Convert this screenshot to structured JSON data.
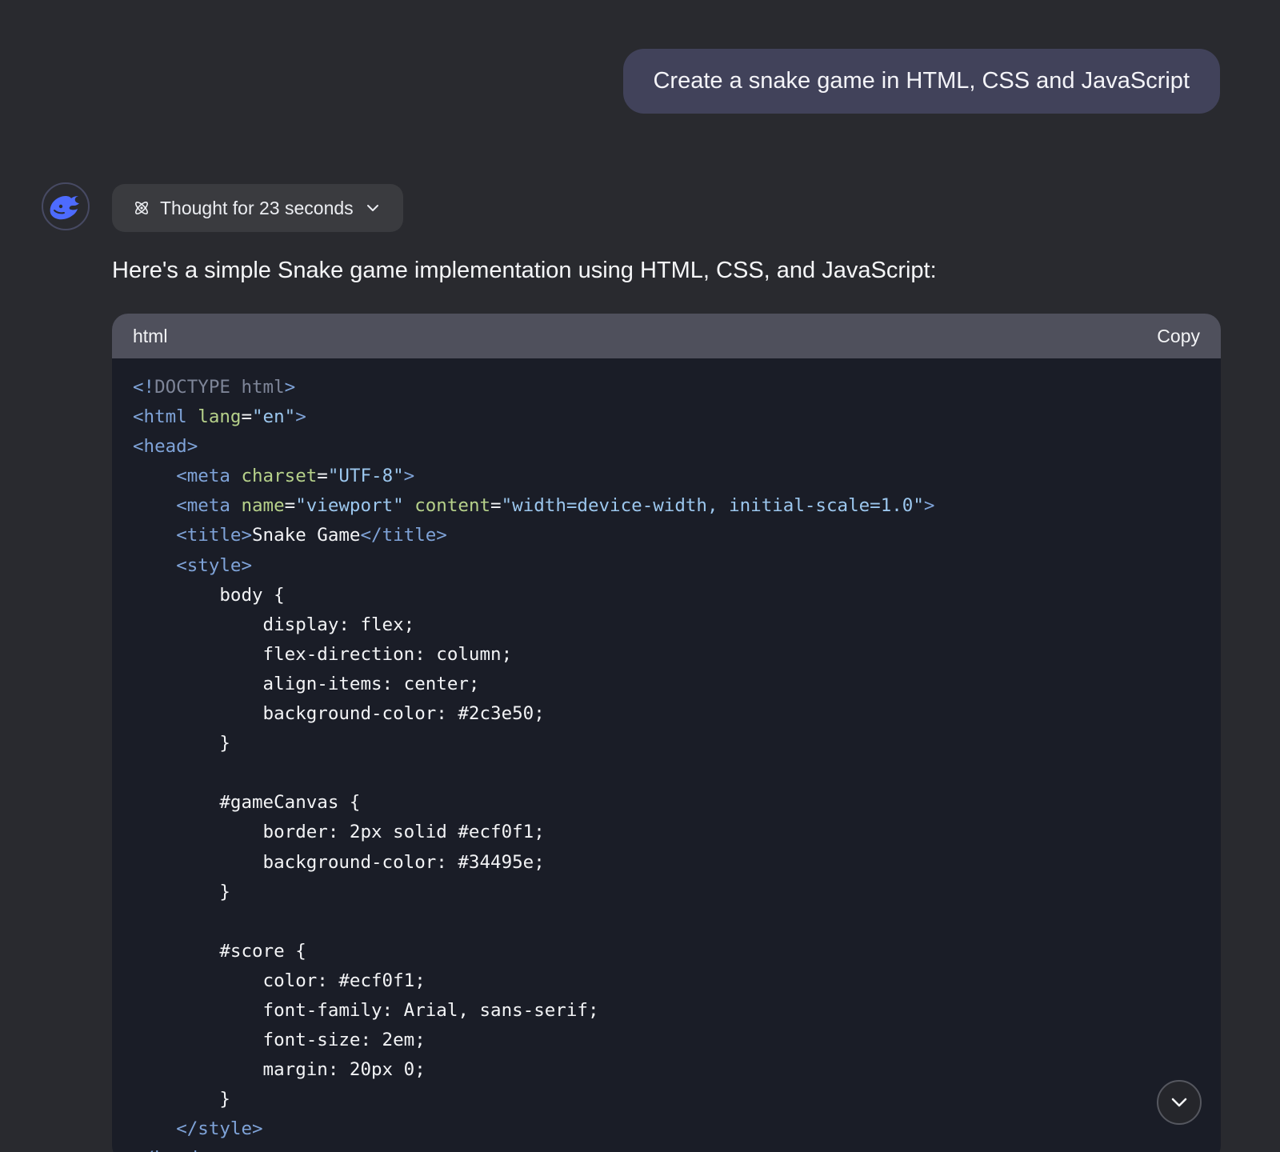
{
  "user_message": "Create a snake game in HTML, CSS and JavaScript",
  "assistant": {
    "avatar_icon": "whale-logo-icon",
    "thought_label": "Thought for 23 seconds",
    "intro_text": "Here's a simple Snake game implementation using HTML, CSS, and JavaScript:",
    "code_block": {
      "language": "html",
      "copy_label": "Copy",
      "lines": [
        [
          {
            "t": "<!",
            "c": "t-bracket"
          },
          {
            "t": "DOCTYPE html",
            "c": "t-doc"
          },
          {
            "t": ">",
            "c": "t-bracket"
          }
        ],
        [
          {
            "t": "<html ",
            "c": "t-tag"
          },
          {
            "t": "lang",
            "c": "t-attr"
          },
          {
            "t": "=",
            "c": "t-plain"
          },
          {
            "t": "\"en\"",
            "c": "t-str"
          },
          {
            "t": ">",
            "c": "t-tag"
          }
        ],
        [
          {
            "t": "<head>",
            "c": "t-tag"
          }
        ],
        [
          {
            "t": "    ",
            "c": "t-plain"
          },
          {
            "t": "<meta ",
            "c": "t-tag"
          },
          {
            "t": "charset",
            "c": "t-attr"
          },
          {
            "t": "=",
            "c": "t-plain"
          },
          {
            "t": "\"UTF-8\"",
            "c": "t-str"
          },
          {
            "t": ">",
            "c": "t-tag"
          }
        ],
        [
          {
            "t": "    ",
            "c": "t-plain"
          },
          {
            "t": "<meta ",
            "c": "t-tag"
          },
          {
            "t": "name",
            "c": "t-attr"
          },
          {
            "t": "=",
            "c": "t-plain"
          },
          {
            "t": "\"viewport\" ",
            "c": "t-str"
          },
          {
            "t": "content",
            "c": "t-attr"
          },
          {
            "t": "=",
            "c": "t-plain"
          },
          {
            "t": "\"width=device-width, initial-scale=1.0\"",
            "c": "t-str"
          },
          {
            "t": ">",
            "c": "t-tag"
          }
        ],
        [
          {
            "t": "    ",
            "c": "t-plain"
          },
          {
            "t": "<title>",
            "c": "t-tag"
          },
          {
            "t": "Snake Game",
            "c": "t-plain"
          },
          {
            "t": "</title>",
            "c": "t-tag"
          }
        ],
        [
          {
            "t": "    ",
            "c": "t-plain"
          },
          {
            "t": "<style>",
            "c": "t-tag"
          }
        ],
        [
          {
            "t": "        body {",
            "c": "t-plain"
          }
        ],
        [
          {
            "t": "            display: flex;",
            "c": "t-plain"
          }
        ],
        [
          {
            "t": "            flex-direction: column;",
            "c": "t-plain"
          }
        ],
        [
          {
            "t": "            align-items: center;",
            "c": "t-plain"
          }
        ],
        [
          {
            "t": "            background-color: #2c3e50;",
            "c": "t-plain"
          }
        ],
        [
          {
            "t": "        }",
            "c": "t-plain"
          }
        ],
        [
          {
            "t": "",
            "c": "t-plain"
          }
        ],
        [
          {
            "t": "        #gameCanvas {",
            "c": "t-plain"
          }
        ],
        [
          {
            "t": "            border: 2px solid #ecf0f1;",
            "c": "t-plain"
          }
        ],
        [
          {
            "t": "            background-color: #34495e;",
            "c": "t-plain"
          }
        ],
        [
          {
            "t": "        }",
            "c": "t-plain"
          }
        ],
        [
          {
            "t": "",
            "c": "t-plain"
          }
        ],
        [
          {
            "t": "        #score {",
            "c": "t-plain"
          }
        ],
        [
          {
            "t": "            color: #ecf0f1;",
            "c": "t-plain"
          }
        ],
        [
          {
            "t": "            font-family: Arial, sans-serif;",
            "c": "t-plain"
          }
        ],
        [
          {
            "t": "            font-size: 2em;",
            "c": "t-plain"
          }
        ],
        [
          {
            "t": "            margin: 20px 0;",
            "c": "t-plain"
          }
        ],
        [
          {
            "t": "        }",
            "c": "t-plain"
          }
        ],
        [
          {
            "t": "    ",
            "c": "t-plain"
          },
          {
            "t": "</style>",
            "c": "t-tag"
          }
        ],
        [
          {
            "t": "</head>",
            "c": "t-tag"
          }
        ]
      ]
    }
  },
  "scroll_button_icon": "chevron-down-icon",
  "colors": {
    "background": "#292a2f",
    "user_bubble": "#41425a",
    "code_header": "#4f505c",
    "code_body": "#1a1d27",
    "brand_blue": "#4d6bfe"
  }
}
